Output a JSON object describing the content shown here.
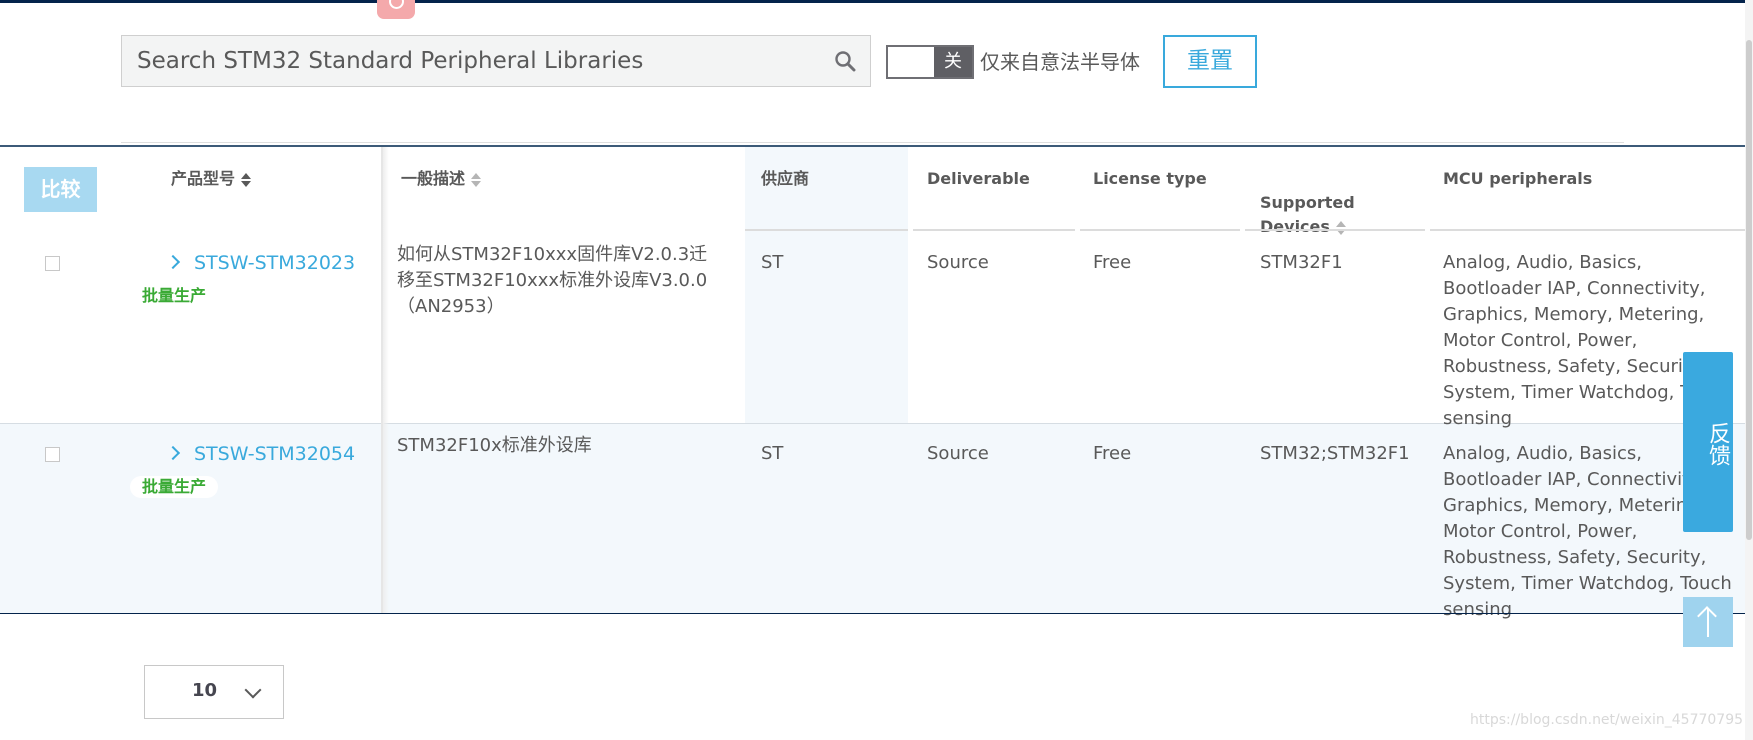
{
  "search": {
    "placeholder": "Search STM32 Standard Peripheral Libraries",
    "icon": "search-icon"
  },
  "toggle": {
    "state_label": "关",
    "label": "仅来自意法半导体"
  },
  "reset_label": "重置",
  "compare_label": "比较",
  "columns": {
    "part_number": "产品型号",
    "description": "一般描述",
    "vendor": "供应商",
    "deliverable": "Deliverable",
    "license": "License type",
    "supported": "Supported\nDevices",
    "mcu": "MCU peripherals"
  },
  "rows": [
    {
      "part": "STSW-STM32023",
      "status": "批量生产",
      "description": "如何从STM32F10xxx固件库V2.0.3迁移至STM32F10xxx标准外设库V3.0.0（AN2953）",
      "vendor": "ST",
      "deliverable": "Source",
      "license": "Free",
      "devices": "STM32F1",
      "mcu": "Analog, Audio, Basics, Bootloader IAP, Connectivity, Graphics, Memory, Metering, Motor Control, Power, Robustness, Safety, Security, System, Timer Watchdog, Touch sensing"
    },
    {
      "part": "STSW-STM32054",
      "status": "批量生产",
      "description": "STM32F10x标准外设库",
      "vendor": "ST",
      "deliverable": "Source",
      "license": "Free",
      "devices": "STM32;STM32F1",
      "mcu": "Analog, Audio, Basics, Bootloader IAP, Connectivity, Graphics, Memory, Metering, Motor Control, Power, Robustness, Safety, Security, System, Timer Watchdog, Touch sensing"
    }
  ],
  "feedback_label": "反馈",
  "pager": {
    "page_size": "10"
  },
  "watermark": "https://blog.csdn.net/weixin_45770795",
  "colors": {
    "accent": "#39a9dc",
    "status_green": "#3aaa35",
    "navy": "#03234b",
    "compare_bg": "#a8d9f1"
  }
}
